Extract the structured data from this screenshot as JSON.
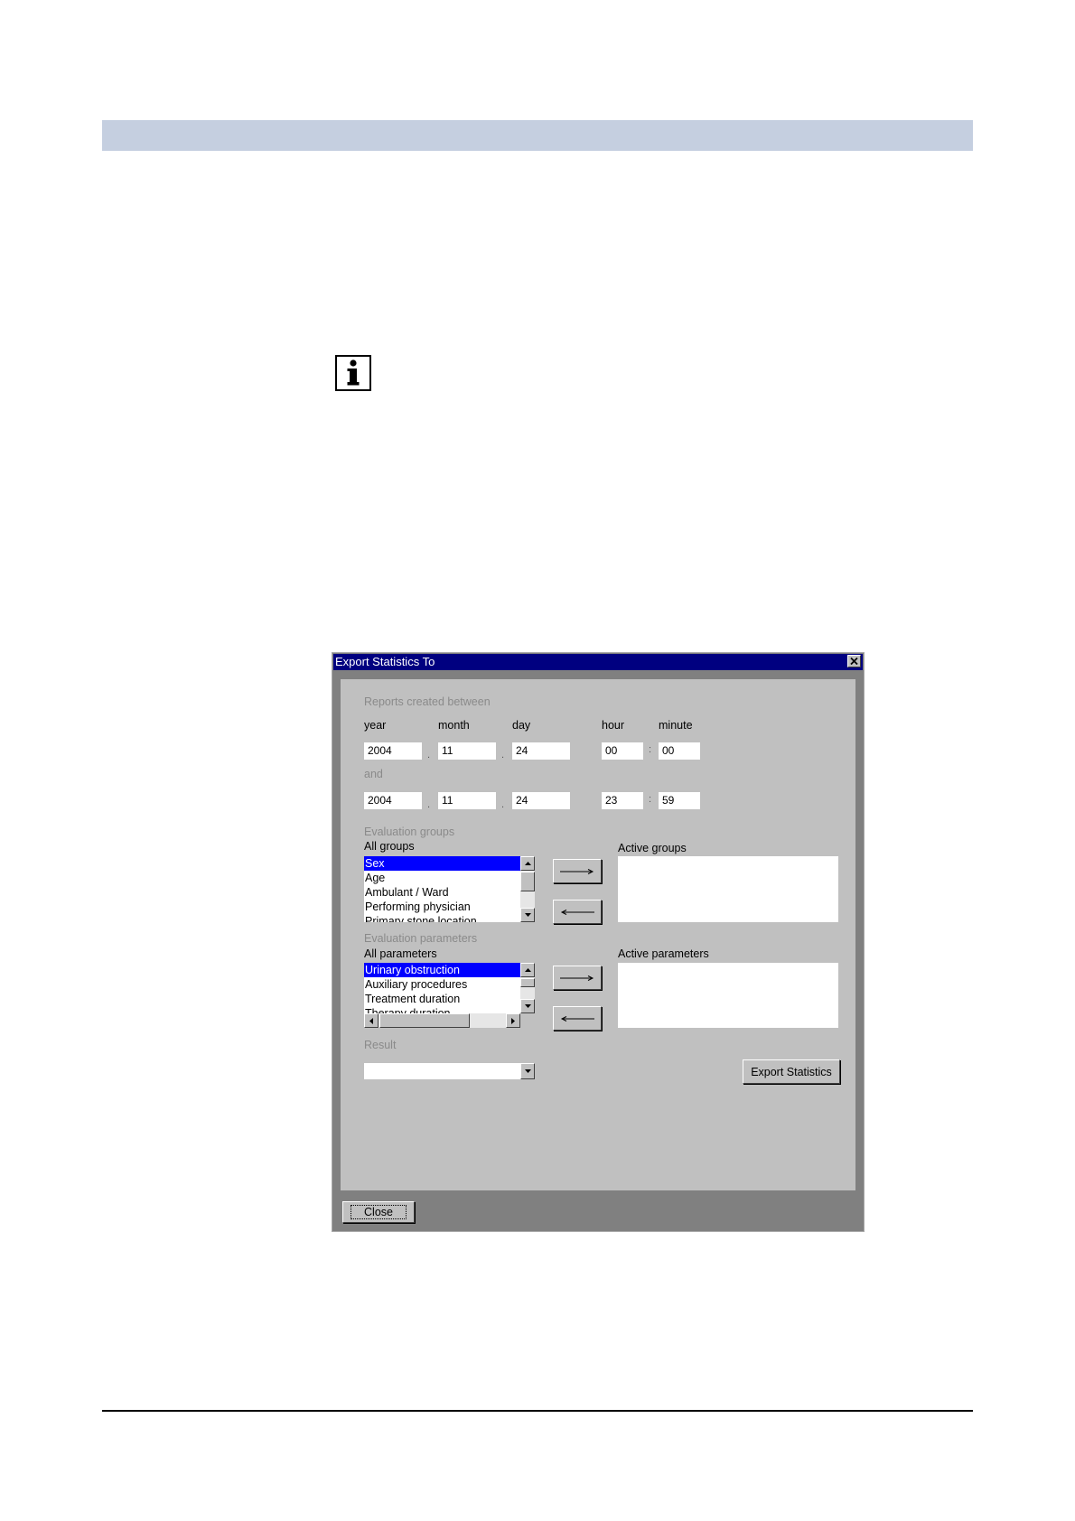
{
  "dialog": {
    "title": "Export Statistics To",
    "reports_label": "Reports created between",
    "col_year": "year",
    "col_month": "month",
    "col_day": "day",
    "col_hour": "hour",
    "col_minute": "minute",
    "start": {
      "year": "2004",
      "month": "11",
      "day": "24",
      "hour": "00",
      "minute": "00"
    },
    "and_label": "and",
    "end": {
      "year": "2004",
      "month": "11",
      "day": "24",
      "hour": "23",
      "minute": "59"
    },
    "date_sep": ".",
    "time_sep": ":",
    "eval_groups_label": "Evaluation groups",
    "all_groups_label": "All groups",
    "groups": [
      "Sex",
      "Age",
      "Ambulant / Ward",
      "Performing physician",
      "Primary stone location"
    ],
    "selected_group_index": 0,
    "active_groups_label": "Active groups",
    "eval_params_label": "Evaluation parameters",
    "all_params_label": "All parameters",
    "params": [
      "Urinary obstruction",
      "Auxiliary procedures",
      "Treatment duration",
      "Therapy duration"
    ],
    "selected_param_index": 0,
    "active_params_label": "Active parameters",
    "result_label": "Result",
    "result_value": "",
    "export_button": "Export Statistics",
    "close_button": "Close"
  },
  "icons": {
    "info": "info-icon",
    "add_arrow": "right-arrow-icon",
    "remove_arrow": "left-arrow-icon"
  },
  "colors": {
    "header_bar": "#c5cfe0",
    "titlebar": "#000080",
    "selection": "#0000ff",
    "dialog_face": "#c0c0c0"
  }
}
